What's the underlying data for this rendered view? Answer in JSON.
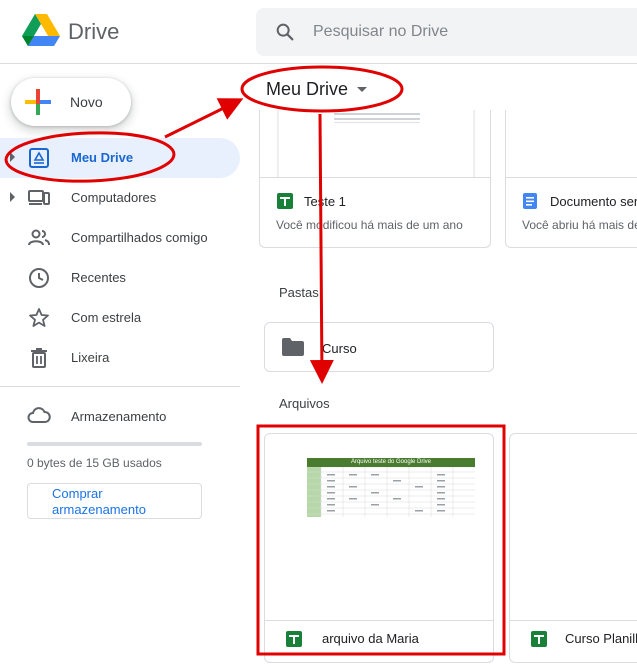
{
  "header": {
    "app_name": "Drive",
    "search": {
      "placeholder": "Pesquisar no Drive"
    }
  },
  "sidebar": {
    "new_button": "Novo",
    "items": [
      {
        "label": "Meu Drive",
        "icon": "my-drive-icon",
        "active": true,
        "expandable": true
      },
      {
        "label": "Computadores",
        "icon": "computers-icon",
        "active": false,
        "expandable": true
      },
      {
        "label": "Compartilhados comigo",
        "icon": "shared-icon",
        "active": false,
        "expandable": false
      },
      {
        "label": "Recentes",
        "icon": "clock-icon",
        "active": false,
        "expandable": false
      },
      {
        "label": "Com estrela",
        "icon": "star-icon",
        "active": false,
        "expandable": false
      },
      {
        "label": "Lixeira",
        "icon": "trash-icon",
        "active": false,
        "expandable": false
      }
    ],
    "storage": {
      "label": "Armazenamento",
      "usage_text": "0 bytes de 15 GB usados",
      "usage_fraction": 0,
      "buy_button": "Comprar armazenamento"
    }
  },
  "main": {
    "title": "Meu Drive",
    "suggested": [
      {
        "title": "Teste 1",
        "subtitle": "Você modificou há mais de um ano",
        "type": "sheets-icon"
      },
      {
        "title": "Documento sem título",
        "subtitle": "Você abriu há mais de um ano",
        "type": "docs-icon"
      }
    ],
    "folders_label": "Pastas",
    "folders": [
      {
        "name": "Curso"
      }
    ],
    "files_label": "Arquivos",
    "files": [
      {
        "name": "arquivo da Maria",
        "type": "sheets-icon",
        "preview_title": "Arquivo teste do Google Drive"
      },
      {
        "name": "Curso Planilhas",
        "type": "sheets-icon"
      }
    ]
  },
  "colors": {
    "accent": "#1a73e8",
    "active_bg": "#e8f0fe",
    "annotation": "#e00000",
    "sheets_green": "#188038",
    "docs_blue": "#4285f4"
  }
}
